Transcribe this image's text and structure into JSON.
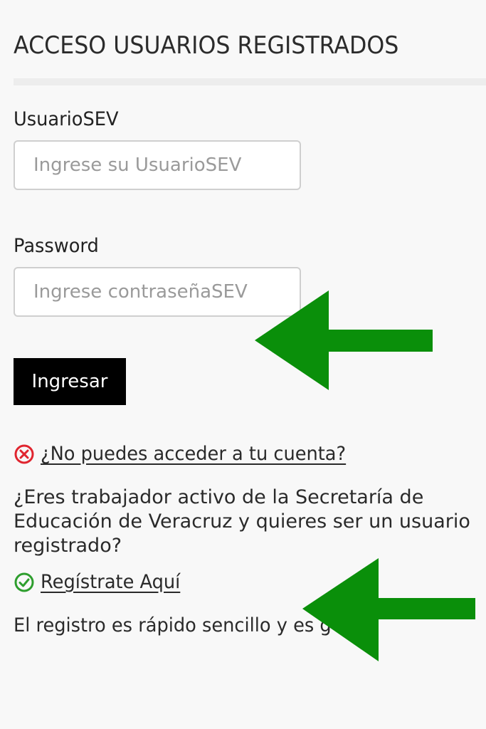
{
  "page": {
    "title": "ACCESO USUARIOS REGISTRADOS"
  },
  "form": {
    "user_label": "UsuarioSEV",
    "user_placeholder": "Ingrese su UsuarioSEV",
    "user_value": "",
    "password_label": "Password",
    "password_placeholder": "Ingrese contraseñaSEV",
    "password_value": "",
    "submit_label": "Ingresar"
  },
  "help": {
    "forgot_icon": "x-circle-icon",
    "forgot_link": "¿No puedes acceder a tu cuenta?",
    "question": "¿Eres trabajador activo de la Secretaría de Educación de Veracruz y quieres ser un usuario registrado?",
    "register_icon": "check-circle-icon",
    "register_link": "Regístrate Aquí",
    "note": "El registro es rápido sencillo y es g"
  },
  "colors": {
    "background": "#f8f8f8",
    "button_bg": "#000000",
    "error_icon": "#e0252f",
    "success_icon": "#2e9e2e",
    "annotation_arrow": "#0a8f0a"
  },
  "annotations": {
    "arrow_icon": "left-arrow-icon"
  }
}
